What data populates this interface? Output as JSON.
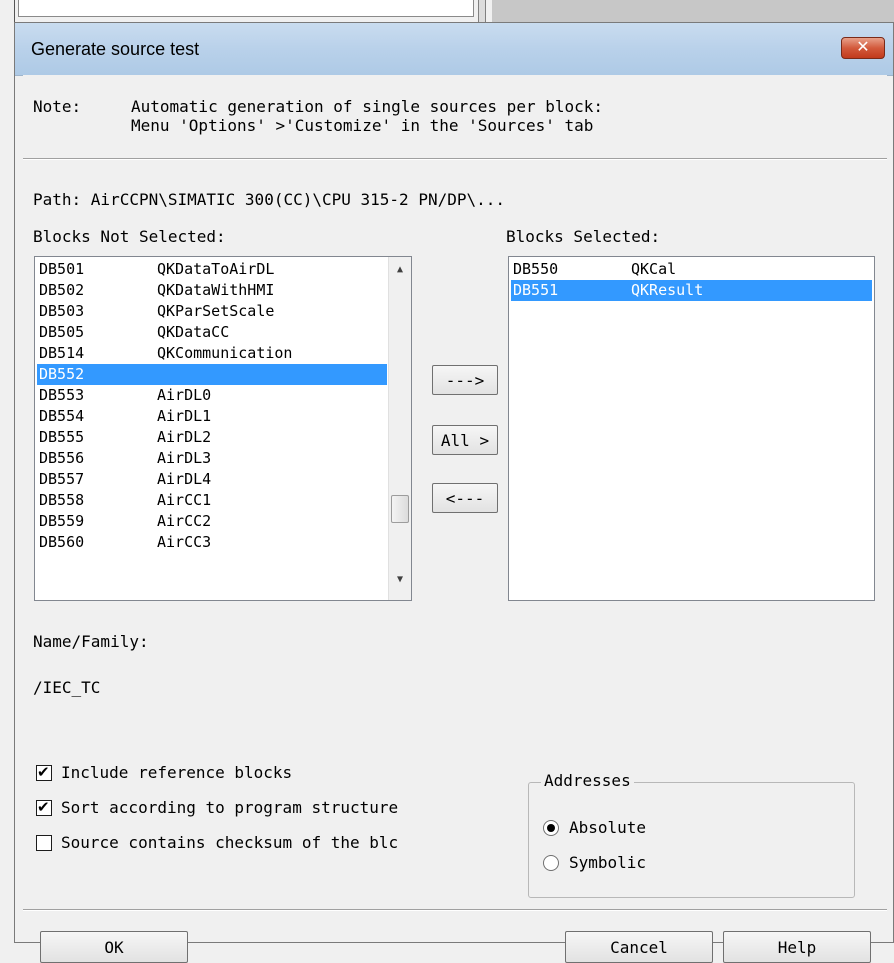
{
  "dialog": {
    "title": "Generate source test",
    "close_glyph": "✕"
  },
  "note": {
    "label": "Note:",
    "line1": "Automatic generation of single sources per block:",
    "line2": "Menu 'Options' >'Customize' in the 'Sources' tab"
  },
  "path": "Path: AirCCPN\\SIMATIC 300(CC)\\CPU 315-2 PN/DP\\...",
  "not_selected": {
    "label": "Blocks Not Selected:",
    "items": [
      {
        "id": "DB501",
        "name": "QKDataToAirDL"
      },
      {
        "id": "DB502",
        "name": "QKDataWithHMI"
      },
      {
        "id": "DB503",
        "name": "QKParSetScale"
      },
      {
        "id": "DB505",
        "name": "QKDataCC"
      },
      {
        "id": "DB514",
        "name": "QKCommunication"
      },
      {
        "id": "DB552",
        "name": "",
        "selected": true
      },
      {
        "id": "DB553",
        "name": "AirDL0"
      },
      {
        "id": "DB554",
        "name": "AirDL1"
      },
      {
        "id": "DB555",
        "name": "AirDL2"
      },
      {
        "id": "DB556",
        "name": "AirDL3"
      },
      {
        "id": "DB557",
        "name": "AirDL4"
      },
      {
        "id": "DB558",
        "name": "AirCC1"
      },
      {
        "id": "DB559",
        "name": "AirCC2"
      },
      {
        "id": "DB560",
        "name": "AirCC3"
      }
    ]
  },
  "selected": {
    "label": "Blocks Selected:",
    "items": [
      {
        "id": "DB550",
        "name": "QKCal"
      },
      {
        "id": "DB551",
        "name": "QKResult",
        "selected": true
      }
    ]
  },
  "transfer": {
    "add": "--->",
    "all": "All >",
    "remove": "<---"
  },
  "name_family": {
    "label": "Name/Family:",
    "value": "/IEC_TC"
  },
  "options": {
    "include_reference": {
      "label": "Include reference blocks",
      "checked": true
    },
    "sort_program": {
      "label": "Sort according to program structure",
      "checked": true
    },
    "checksum": {
      "label": "Source contains checksum of the blc",
      "checked": false
    }
  },
  "addresses": {
    "title": "Addresses",
    "absolute": "Absolute",
    "symbolic": "Symbolic",
    "value": "Absolute"
  },
  "buttons": {
    "ok": "OK",
    "cancel": "Cancel",
    "help": "Help"
  },
  "colors": {
    "selection": "#3399ff",
    "close_button": "#c7503a"
  },
  "icons": {
    "check": "✔",
    "scroll_up": "▲",
    "scroll_down": "▼"
  }
}
